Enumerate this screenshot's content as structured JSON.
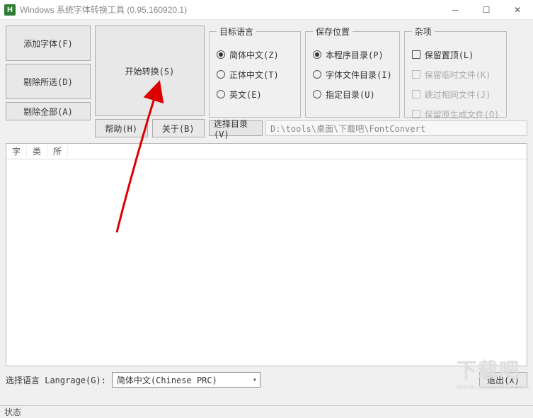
{
  "window": {
    "icon_letter": "H",
    "title": "Windows 系统字体转换工具 (0.95.160920.1)"
  },
  "buttons": {
    "add_font": "添加字体(F)",
    "remove_selected": "剔除所选(D)",
    "remove_all": "剔除全部(A)",
    "start": "开始转换(S)",
    "help": "帮助(H)",
    "about": "关于(B)",
    "select_dir": "选择目录(V)",
    "exit": "退出(X)"
  },
  "groups": {
    "target_lang": {
      "legend": "目标语言",
      "opts": [
        "简体中文(Z)",
        "正体中文(T)",
        "英文(E)"
      ],
      "selected": 0
    },
    "save_loc": {
      "legend": "保存位置",
      "opts": [
        "本程序目录(P)",
        "字体文件目录(I)",
        "指定目录(U)"
      ],
      "selected": 0
    },
    "misc": {
      "legend": "杂项",
      "opts": [
        "保留置顶(L)",
        "保留临时文件(K)",
        "跳过相同文件(J)",
        "保留原生成文件(O)"
      ]
    }
  },
  "path": "D:\\tools\\桌面\\下载吧\\FontConvert",
  "table": {
    "cols": [
      "字",
      "类",
      "所"
    ]
  },
  "language": {
    "label": "选择语言 Langrage(G):",
    "value": "简体中文(Chinese PRC)"
  },
  "status": "状态",
  "watermark": {
    "big": "下载吧",
    "small": "www.xiazaiba.com"
  }
}
